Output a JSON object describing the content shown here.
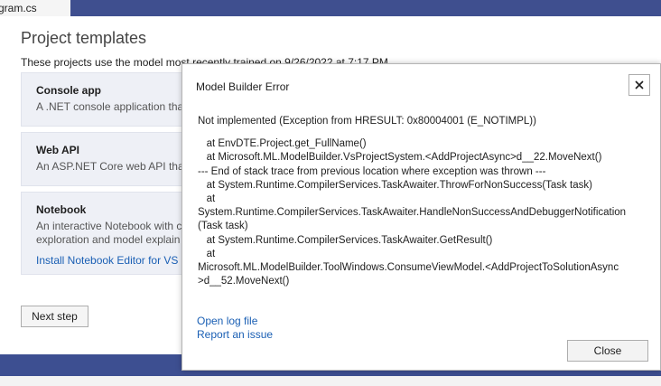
{
  "file_tab": {
    "label": "gram.cs"
  },
  "page": {
    "title": "Project templates",
    "description": "These projects use the model most recently trained on 9/26/2022 at 7:17 PM.",
    "cards": [
      {
        "title": "Console app",
        "description": "A .NET console application tha"
      },
      {
        "title": "Web API",
        "description": "An ASP.NET Core web API that"
      },
      {
        "title": "Notebook",
        "description_lines": [
          "An interactive Notebook with c",
          "exploration and model explain"
        ],
        "link": "Install Notebook Editor for VS 2"
      }
    ],
    "next_button": "Next step"
  },
  "dialog": {
    "title": "Model Builder Error",
    "close_icon": "close-icon",
    "message": "Not implemented (Exception from HRESULT: 0x80004001 (E_NOTIMPL))",
    "stack": [
      "   at EnvDTE.Project.get_FullName()",
      "   at Microsoft.ML.ModelBuilder.VsProjectSystem.<AddProjectAsync>d__22.MoveNext()",
      "--- End of stack trace from previous location where exception was thrown ---",
      "   at System.Runtime.CompilerServices.TaskAwaiter.ThrowForNonSuccess(Task task)",
      "   at",
      "System.Runtime.CompilerServices.TaskAwaiter.HandleNonSuccessAndDebuggerNotification",
      "(Task task)",
      "   at System.Runtime.CompilerServices.TaskAwaiter.GetResult()",
      "   at",
      "Microsoft.ML.ModelBuilder.ToolWindows.ConsumeViewModel.<AddProjectToSolutionAsync",
      ">d__52.MoveNext()"
    ],
    "open_log_link": "Open log file",
    "report_link": "Report an issue",
    "close_button": "Close"
  }
}
